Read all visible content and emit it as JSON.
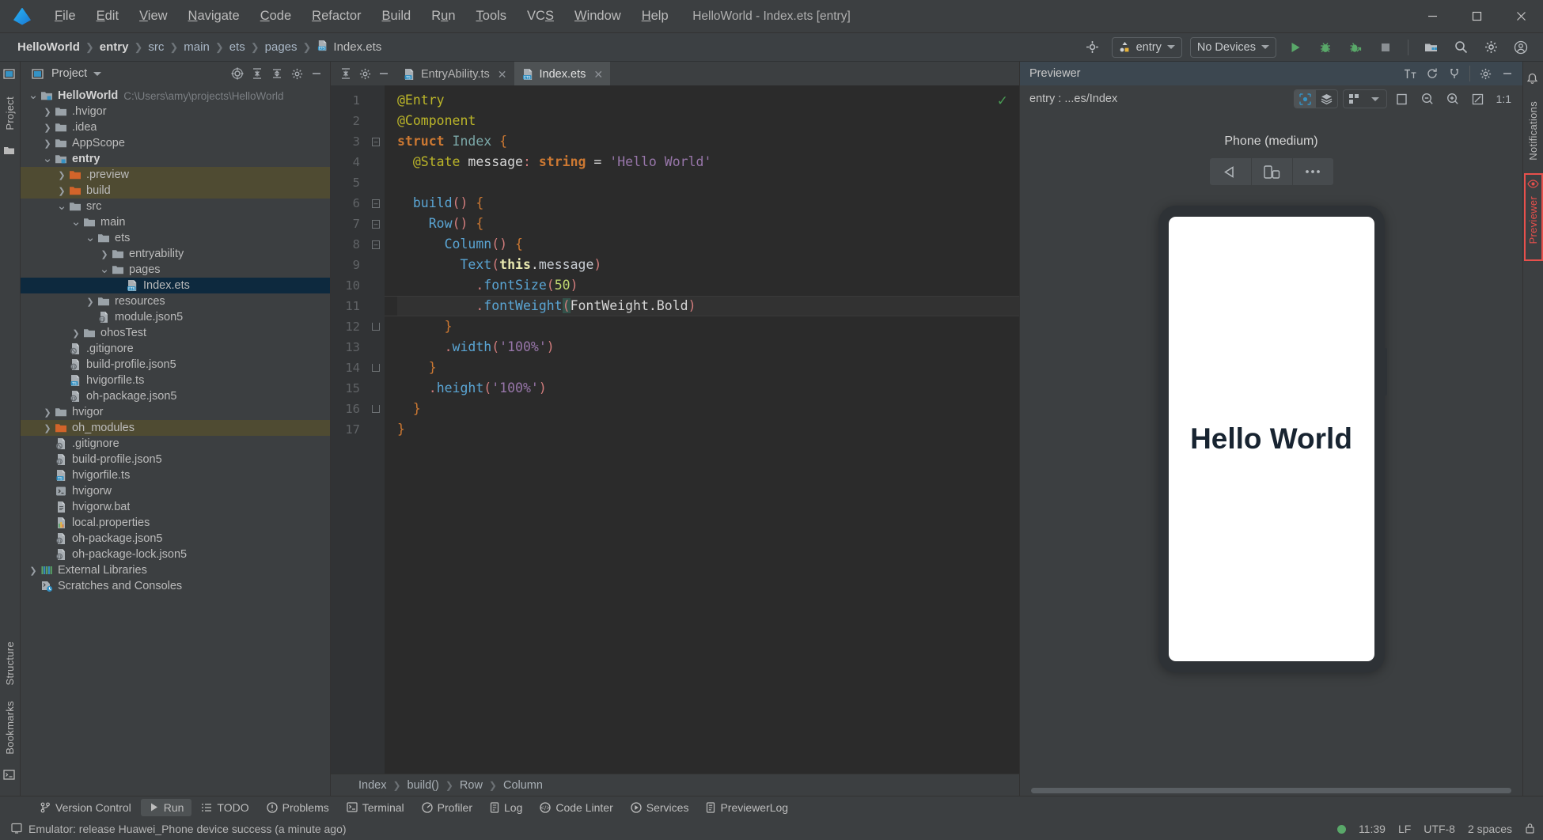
{
  "window": {
    "title": "HelloWorld - Index.ets [entry]",
    "logo": "ide-logo-icon",
    "controls": [
      "minimize-button",
      "maximize-button",
      "close-button"
    ]
  },
  "menubar": [
    {
      "label": "File",
      "mnemonic": "F"
    },
    {
      "label": "Edit",
      "mnemonic": "E"
    },
    {
      "label": "View",
      "mnemonic": "V"
    },
    {
      "label": "Navigate",
      "mnemonic": "N"
    },
    {
      "label": "Code",
      "mnemonic": "C"
    },
    {
      "label": "Refactor",
      "mnemonic": "R"
    },
    {
      "label": "Build",
      "mnemonic": "B"
    },
    {
      "label": "Run",
      "mnemonic": "u"
    },
    {
      "label": "Tools",
      "mnemonic": "T"
    },
    {
      "label": "VCS",
      "mnemonic": "S"
    },
    {
      "label": "Window",
      "mnemonic": "W"
    },
    {
      "label": "Help",
      "mnemonic": "H"
    }
  ],
  "breadcrumb": {
    "items": [
      "HelloWorld",
      "entry",
      "src",
      "main",
      "ets",
      "pages"
    ],
    "file": "Index.ets",
    "file_icon": "ets-file-icon"
  },
  "toolbar": {
    "target_icon": "target-icon",
    "run_config": "entry",
    "device": "No Devices",
    "buttons": [
      {
        "name": "run-button",
        "icon": "play-icon",
        "color": "#59a869"
      },
      {
        "name": "debug-button",
        "icon": "bug-icon",
        "color": "#59a869"
      },
      {
        "name": "attach-debugger-button",
        "icon": "bug-attach-icon",
        "color": "#59a869"
      },
      {
        "name": "stop-button",
        "icon": "stop-square-icon",
        "color": "#8a8f93"
      },
      {
        "name": "device-manager-button",
        "icon": "device-manager-icon",
        "color": "#b8bcc0"
      },
      {
        "name": "search-everywhere-button",
        "icon": "search-icon",
        "color": "#b8bcc0"
      },
      {
        "name": "settings-button",
        "icon": "gear-icon",
        "color": "#b8bcc0"
      },
      {
        "name": "account-button",
        "icon": "account-icon",
        "color": "#b8bcc0"
      }
    ]
  },
  "left_rail": {
    "top": [
      "Project"
    ],
    "bottom": [
      "Structure",
      "Bookmarks"
    ]
  },
  "right_rail": {
    "top": [
      "Notifications"
    ],
    "highlighted": "Previewer"
  },
  "project_panel": {
    "title": "Project",
    "header_icons": [
      "select-opened-file-icon",
      "expand-all-icon",
      "collapse-all-icon",
      "settings-icon",
      "hide-icon"
    ],
    "tree": [
      {
        "label": "HelloWorld",
        "path": "C:\\Users\\amy\\projects\\HelloWorld",
        "indent": 0,
        "arrow": "down",
        "icon": "module-folder-icon",
        "bold": true,
        "state": "normal"
      },
      {
        "label": ".hvigor",
        "indent": 1,
        "arrow": "right",
        "icon": "folder-icon",
        "state": "normal"
      },
      {
        "label": ".idea",
        "indent": 1,
        "arrow": "right",
        "icon": "folder-icon",
        "state": "normal"
      },
      {
        "label": "AppScope",
        "indent": 1,
        "arrow": "right",
        "icon": "folder-icon",
        "state": "normal"
      },
      {
        "label": "entry",
        "indent": 1,
        "arrow": "down",
        "icon": "module-folder-icon",
        "bold": true,
        "state": "normal"
      },
      {
        "label": ".preview",
        "indent": 2,
        "arrow": "right",
        "icon": "excluded-folder-icon",
        "state": "excluded"
      },
      {
        "label": "build",
        "indent": 2,
        "arrow": "right",
        "icon": "excluded-folder-icon",
        "state": "excluded"
      },
      {
        "label": "src",
        "indent": 2,
        "arrow": "down",
        "icon": "folder-icon",
        "state": "normal"
      },
      {
        "label": "main",
        "indent": 3,
        "arrow": "down",
        "icon": "folder-icon",
        "state": "normal"
      },
      {
        "label": "ets",
        "indent": 4,
        "arrow": "down",
        "icon": "folder-icon",
        "state": "normal"
      },
      {
        "label": "entryability",
        "indent": 5,
        "arrow": "right",
        "icon": "folder-icon",
        "state": "normal"
      },
      {
        "label": "pages",
        "indent": 5,
        "arrow": "down",
        "icon": "folder-icon",
        "state": "normal"
      },
      {
        "label": "Index.ets",
        "indent": 6,
        "arrow": "none",
        "icon": "ets-file-icon",
        "state": "selected"
      },
      {
        "label": "resources",
        "indent": 4,
        "arrow": "right",
        "icon": "folder-icon",
        "state": "normal"
      },
      {
        "label": "module.json5",
        "indent": 4,
        "arrow": "none",
        "icon": "json5-file-icon",
        "state": "normal"
      },
      {
        "label": "ohosTest",
        "indent": 3,
        "arrow": "right",
        "icon": "folder-icon",
        "state": "normal"
      },
      {
        "label": ".gitignore",
        "indent": 2,
        "arrow": "none",
        "icon": "gitignore-file-icon",
        "state": "normal"
      },
      {
        "label": "build-profile.json5",
        "indent": 2,
        "arrow": "none",
        "icon": "json5-file-icon",
        "state": "normal"
      },
      {
        "label": "hvigorfile.ts",
        "indent": 2,
        "arrow": "none",
        "icon": "ts-file-icon",
        "state": "normal"
      },
      {
        "label": "oh-package.json5",
        "indent": 2,
        "arrow": "none",
        "icon": "json5-file-icon",
        "state": "normal"
      },
      {
        "label": "hvigor",
        "indent": 1,
        "arrow": "right",
        "icon": "folder-icon",
        "state": "normal"
      },
      {
        "label": "oh_modules",
        "indent": 1,
        "arrow": "right",
        "icon": "excluded-folder-icon",
        "state": "excluded"
      },
      {
        "label": ".gitignore",
        "indent": 1,
        "arrow": "none",
        "icon": "gitignore-file-icon",
        "state": "normal"
      },
      {
        "label": "build-profile.json5",
        "indent": 1,
        "arrow": "none",
        "icon": "json5-file-icon",
        "state": "normal"
      },
      {
        "label": "hvigorfile.ts",
        "indent": 1,
        "arrow": "none",
        "icon": "ts-file-icon",
        "state": "normal"
      },
      {
        "label": "hvigorw",
        "indent": 1,
        "arrow": "none",
        "icon": "script-file-icon",
        "state": "normal"
      },
      {
        "label": "hvigorw.bat",
        "indent": 1,
        "arrow": "none",
        "icon": "bat-file-icon",
        "state": "normal"
      },
      {
        "label": "local.properties",
        "indent": 1,
        "arrow": "none",
        "icon": "properties-file-icon",
        "state": "normal"
      },
      {
        "label": "oh-package.json5",
        "indent": 1,
        "arrow": "none",
        "icon": "json5-file-icon",
        "state": "normal"
      },
      {
        "label": "oh-package-lock.json5",
        "indent": 1,
        "arrow": "none",
        "icon": "json5-file-icon",
        "state": "normal"
      },
      {
        "label": "External Libraries",
        "indent": 0,
        "arrow": "right",
        "icon": "libraries-icon",
        "state": "normal"
      },
      {
        "label": "Scratches and Consoles",
        "indent": 0,
        "arrow": "none",
        "icon": "scratches-icon",
        "state": "normal"
      }
    ]
  },
  "editor": {
    "tabs": [
      {
        "label": "EntryAbility.ts",
        "icon": "ts-file-icon",
        "active": false
      },
      {
        "label": "Index.ets",
        "icon": "ets-file-icon",
        "active": true
      }
    ],
    "line_numbers": [
      1,
      2,
      3,
      4,
      5,
      6,
      7,
      8,
      9,
      10,
      11,
      12,
      13,
      14,
      15,
      16,
      17
    ],
    "inspection_status": "ok-check-icon",
    "current_line": 11,
    "code_lines": [
      "@Entry",
      "@Component",
      "struct Index {",
      "  @State message: string = 'Hello World'",
      "",
      "  build() {",
      "    Row() {",
      "      Column() {",
      "        Text(this.message)",
      "          .fontSize(50)",
      "          .fontWeight(FontWeight.Bold)",
      "      }",
      "      .width('100%')",
      "    }",
      "    .height('100%')",
      "  }",
      "}"
    ],
    "breadcrumb": [
      "Index",
      "build()",
      "Row",
      "Column"
    ]
  },
  "previewer": {
    "title": "Previewer",
    "header_icons": [
      "font-size-icon",
      "refresh-icon",
      "plug-icon",
      "gear-icon",
      "minimize-icon"
    ],
    "path_label": "entry : ...es/Index",
    "toggle_buttons": [
      {
        "name": "inspector-toggle",
        "icon": "inspector-icon",
        "active": true
      },
      {
        "name": "layers-toggle",
        "icon": "layers-icon",
        "active": false
      }
    ],
    "profile_button": {
      "name": "multi-device-button",
      "icon": "grid-icon"
    },
    "zoom_icons": [
      "fit-icon",
      "zoom-out-icon",
      "zoom-in-icon",
      "actual-size-icon"
    ],
    "zoom_level": "1:1",
    "device_name": "Phone (medium)",
    "device_controls": [
      "rotate-left-icon",
      "orientation-icon",
      "more-icon"
    ],
    "screen_text": "Hello World"
  },
  "tool_windows": [
    {
      "label": "Version Control",
      "icon": "vcs-icon",
      "active": false
    },
    {
      "label": "Run",
      "icon": "play-icon",
      "active": true
    },
    {
      "label": "TODO",
      "icon": "todo-icon",
      "active": false
    },
    {
      "label": "Problems",
      "icon": "problems-icon",
      "active": false
    },
    {
      "label": "Terminal",
      "icon": "terminal-icon",
      "active": false
    },
    {
      "label": "Profiler",
      "icon": "profiler-icon",
      "active": false
    },
    {
      "label": "Log",
      "icon": "log-icon",
      "active": false
    },
    {
      "label": "Code Linter",
      "icon": "linter-icon",
      "active": false
    },
    {
      "label": "Services",
      "icon": "services-icon",
      "active": false
    },
    {
      "label": "PreviewerLog",
      "icon": "previewer-log-icon",
      "active": false
    }
  ],
  "statusbar": {
    "message_icon": "terminal-small-icon",
    "message": "Emulator: release Huawei_Phone device success (a minute ago)",
    "time": "11:39",
    "line_separator": "LF",
    "encoding": "UTF-8",
    "indent": "2 spaces",
    "status_color": "#59a869"
  },
  "colors": {
    "accent_blue": "#3592c4",
    "selected_row": "#0d293e",
    "excluded_row": "#4f4b32",
    "highlight_red": "#e8504c",
    "run_green": "#59a869"
  }
}
